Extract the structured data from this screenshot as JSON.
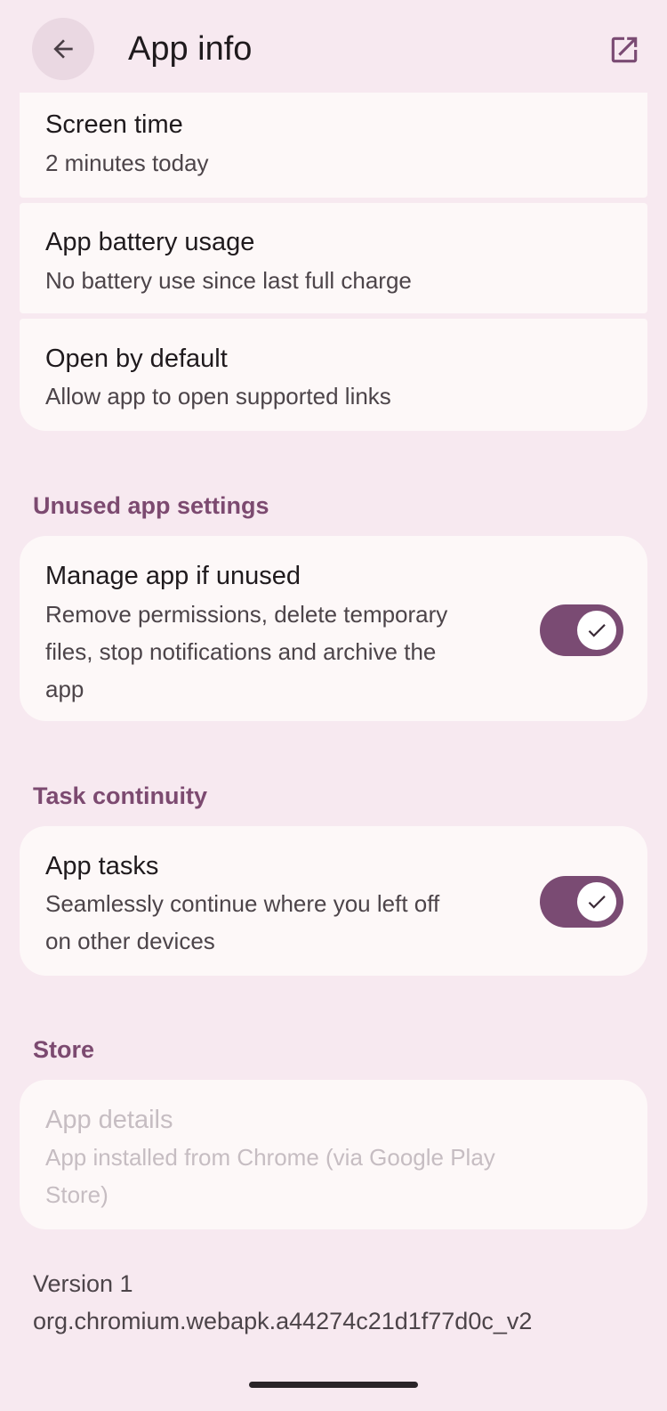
{
  "header": {
    "title": "App info",
    "back_icon": "arrow-back-icon",
    "open_icon": "open-in-new-icon"
  },
  "items": {
    "screen_time": {
      "title": "Screen time",
      "subtitle": "2 minutes today"
    },
    "battery": {
      "title": "App battery usage",
      "subtitle": "No battery use since last full charge"
    },
    "open_default": {
      "title": "Open by default",
      "subtitle": "Allow app to open supported links"
    }
  },
  "unused": {
    "header": "Unused app settings",
    "title": "Manage app if unused",
    "subtitle_lines": [
      "Remove permissions, delete temporary",
      "files, stop notifications and archive the",
      "app"
    ],
    "toggle_on": true
  },
  "continuity": {
    "header": "Task continuity",
    "title": "App tasks",
    "subtitle_lines": [
      "Seamlessly continue where you left off",
      "on other devices"
    ],
    "toggle_on": true
  },
  "store": {
    "header": "Store",
    "title": "App details",
    "subtitle_lines": [
      "App installed from Chrome (via Google Play",
      "Store)"
    ]
  },
  "footer": {
    "version": "Version 1",
    "package": "org.chromium.webapk.a44274c21d1f77d0c_v2"
  },
  "colors": {
    "background": "#f7e9f0",
    "card": "#fdf8f8",
    "accent": "#7a4b73",
    "section_header": "#7c4a70"
  }
}
